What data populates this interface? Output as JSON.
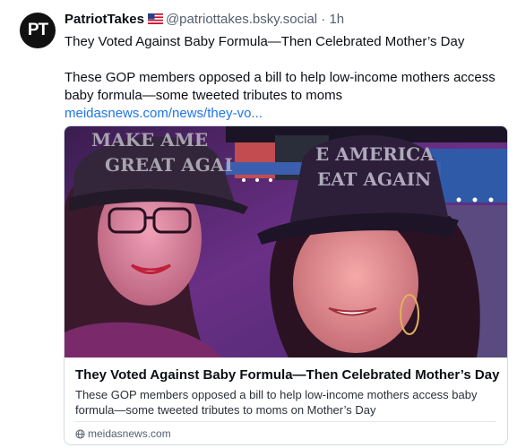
{
  "author": {
    "avatar_text": "PT",
    "display_name": "PatriotTakes",
    "flag_icon": "us-flag-icon",
    "handle": "@patriottakes.bsky.social",
    "separator": "·",
    "time": "1h"
  },
  "post": {
    "headline": "They Voted Against Baby Formula—Then Celebrated Mother’s Day",
    "body": "These GOP members opposed a bill to help low-income mothers access baby formula—some tweeted tributes to moms",
    "link_text": "meidasnews.com/news/they-vo..."
  },
  "card": {
    "image_hat_left": "MAKE AMERICA GREAT AGAIN",
    "image_hat_right": "MAKE AMERICA GREAT AGAIN",
    "title": "They Voted Against Baby Formula—Then Celebrated Mother’s Day",
    "description": "These GOP members opposed a bill to help low-income mothers access baby formula—some tweeted tributes to moms on Mother’s Day",
    "domain_icon": "globe-icon",
    "domain": "meidasnews.com"
  },
  "colors": {
    "link": "#1e76e8",
    "muted": "#55606e",
    "card_border": "#d4dbe2"
  }
}
